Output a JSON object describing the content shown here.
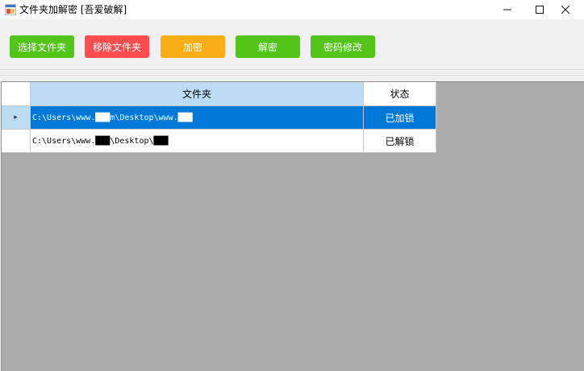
{
  "window": {
    "title": "文件夹加解密 [吾爱破解]",
    "controls": {
      "minimize": "—",
      "maximize": "☐",
      "close": "✕"
    }
  },
  "toolbar": {
    "buttons": [
      {
        "label": "选择文件夹",
        "color": "#52c41a"
      },
      {
        "label": "移除文件夹",
        "color": "#ff4d4f"
      },
      {
        "label": "加密",
        "color": "#faad14"
      },
      {
        "label": "解密",
        "color": "#52c41a"
      },
      {
        "label": "密码修改",
        "color": "#52c41a"
      }
    ]
  },
  "table": {
    "columns": [
      "文件夹",
      "状态"
    ],
    "row_indicator": "▸",
    "rows": [
      {
        "folder": "C:\\Users\\www.███m\\Desktop\\www.███",
        "status": "已加锁",
        "selected": true
      },
      {
        "folder": "C:\\Users\\www.███\\Desktop\\███",
        "status": "已解锁",
        "selected": false
      }
    ]
  },
  "colors": {
    "selection": "#0078d7",
    "header_selected": "#bcdcf4",
    "grid_background": "#ababab"
  }
}
